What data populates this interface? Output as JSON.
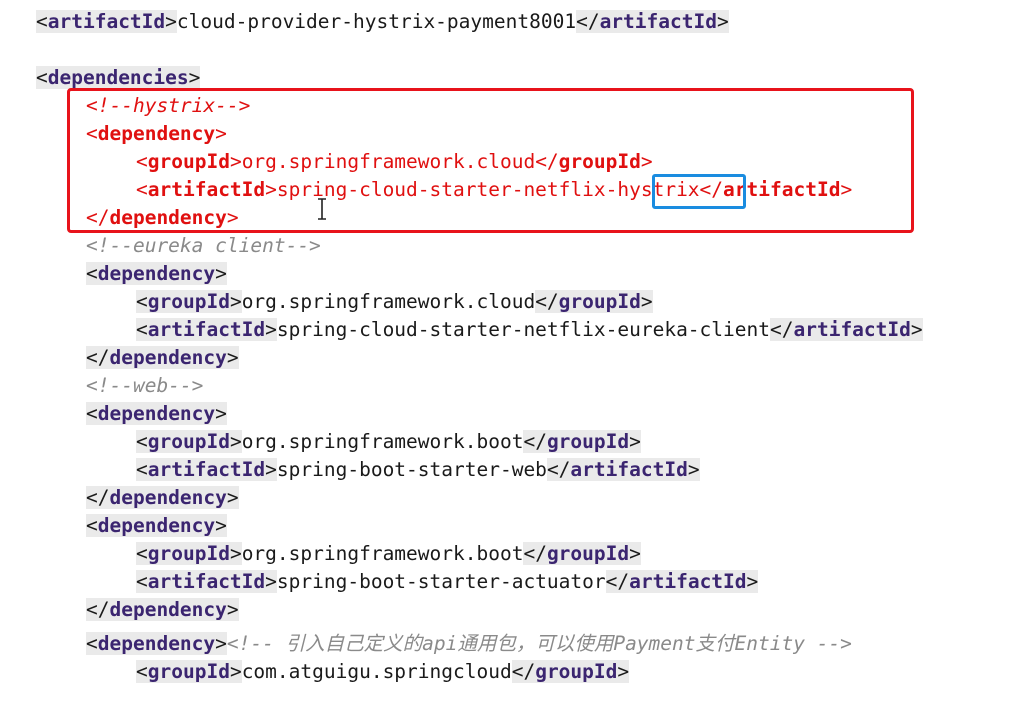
{
  "editor": {
    "lines": [
      {
        "tokens": [
          {
            "k": "br",
            "t": "<"
          },
          {
            "k": "tag",
            "t": "artifactId"
          },
          {
            "k": "br",
            "t": ">"
          },
          {
            "k": "text",
            "t": "cloud-provider-hystrix-payment8001"
          },
          {
            "k": "br",
            "t": "</"
          },
          {
            "k": "tag",
            "t": "artifactId"
          },
          {
            "k": "br",
            "t": ">"
          }
        ]
      },
      {
        "tokens": []
      },
      {
        "tokens": [
          {
            "k": "br",
            "t": "<"
          },
          {
            "k": "tag",
            "t": "dependencies"
          },
          {
            "k": "br",
            "t": ">"
          }
        ]
      },
      {
        "hl": true,
        "tokens": [
          {
            "k": "comment",
            "t": "<!--hystrix-->"
          }
        ]
      },
      {
        "hl": true,
        "tokens": [
          {
            "k": "br",
            "t": "<"
          },
          {
            "k": "tag",
            "t": "dependency"
          },
          {
            "k": "br",
            "t": ">"
          }
        ]
      },
      {
        "hl": true,
        "tokens": [
          {
            "k": "br",
            "t": "<"
          },
          {
            "k": "tag",
            "t": "groupId"
          },
          {
            "k": "br",
            "t": ">"
          },
          {
            "k": "text",
            "t": "org.springframework.cloud"
          },
          {
            "k": "br",
            "t": "</"
          },
          {
            "k": "tag",
            "t": "groupId"
          },
          {
            "k": "br",
            "t": ">"
          }
        ]
      },
      {
        "hl": true,
        "tokens": [
          {
            "k": "br",
            "t": "<"
          },
          {
            "k": "tag",
            "t": "artifactId"
          },
          {
            "k": "br",
            "t": ">"
          },
          {
            "k": "text",
            "t": "spring-cloud-starter-netflix-hystrix"
          },
          {
            "k": "br",
            "t": "</"
          },
          {
            "k": "tag",
            "t": "artifactId"
          },
          {
            "k": "br",
            "t": ">"
          }
        ]
      },
      {
        "hl": true,
        "tokens": [
          {
            "k": "br",
            "t": "</"
          },
          {
            "k": "tag",
            "t": "dependency"
          },
          {
            "k": "br",
            "t": ">"
          }
        ]
      },
      {
        "tokens": [
          {
            "k": "comment",
            "t": "<!--eureka client-->"
          }
        ]
      },
      {
        "tokens": [
          {
            "k": "br",
            "t": "<"
          },
          {
            "k": "tag",
            "t": "dependency"
          },
          {
            "k": "br",
            "t": ">"
          }
        ]
      },
      {
        "tokens": [
          {
            "k": "br",
            "t": "<"
          },
          {
            "k": "tag",
            "t": "groupId"
          },
          {
            "k": "br",
            "t": ">"
          },
          {
            "k": "text",
            "t": "org.springframework.cloud"
          },
          {
            "k": "br",
            "t": "</"
          },
          {
            "k": "tag",
            "t": "groupId"
          },
          {
            "k": "br",
            "t": ">"
          }
        ]
      },
      {
        "tokens": [
          {
            "k": "br",
            "t": "<"
          },
          {
            "k": "tag",
            "t": "artifactId"
          },
          {
            "k": "br",
            "t": ">"
          },
          {
            "k": "text",
            "t": "spring-cloud-starter-netflix-eureka-client"
          },
          {
            "k": "br",
            "t": "</"
          },
          {
            "k": "tag",
            "t": "artifactId"
          },
          {
            "k": "br",
            "t": ">"
          }
        ]
      },
      {
        "tokens": [
          {
            "k": "br",
            "t": "</"
          },
          {
            "k": "tag",
            "t": "dependency"
          },
          {
            "k": "br",
            "t": ">"
          }
        ]
      },
      {
        "tokens": [
          {
            "k": "comment",
            "t": "<!--web-->"
          }
        ]
      },
      {
        "tokens": [
          {
            "k": "br",
            "t": "<"
          },
          {
            "k": "tag",
            "t": "dependency"
          },
          {
            "k": "br",
            "t": ">"
          }
        ]
      },
      {
        "tokens": [
          {
            "k": "br",
            "t": "<"
          },
          {
            "k": "tag",
            "t": "groupId"
          },
          {
            "k": "br",
            "t": ">"
          },
          {
            "k": "text",
            "t": "org.springframework.boot"
          },
          {
            "k": "br",
            "t": "</"
          },
          {
            "k": "tag",
            "t": "groupId"
          },
          {
            "k": "br",
            "t": ">"
          }
        ]
      },
      {
        "tokens": [
          {
            "k": "br",
            "t": "<"
          },
          {
            "k": "tag",
            "t": "artifactId"
          },
          {
            "k": "br",
            "t": ">"
          },
          {
            "k": "text",
            "t": "spring-boot-starter-web"
          },
          {
            "k": "br",
            "t": "</"
          },
          {
            "k": "tag",
            "t": "artifactId"
          },
          {
            "k": "br",
            "t": ">"
          }
        ]
      },
      {
        "tokens": [
          {
            "k": "br",
            "t": "</"
          },
          {
            "k": "tag",
            "t": "dependency"
          },
          {
            "k": "br",
            "t": ">"
          }
        ]
      },
      {
        "tokens": [
          {
            "k": "br",
            "t": "<"
          },
          {
            "k": "tag",
            "t": "dependency"
          },
          {
            "k": "br",
            "t": ">"
          }
        ]
      },
      {
        "tokens": [
          {
            "k": "br",
            "t": "<"
          },
          {
            "k": "tag",
            "t": "groupId"
          },
          {
            "k": "br",
            "t": ">"
          },
          {
            "k": "text",
            "t": "org.springframework.boot"
          },
          {
            "k": "br",
            "t": "</"
          },
          {
            "k": "tag",
            "t": "groupId"
          },
          {
            "k": "br",
            "t": ">"
          }
        ]
      },
      {
        "tokens": [
          {
            "k": "br",
            "t": "<"
          },
          {
            "k": "tag",
            "t": "artifactId"
          },
          {
            "k": "br",
            "t": ">"
          },
          {
            "k": "text",
            "t": "spring-boot-starter-actuator"
          },
          {
            "k": "br",
            "t": "</"
          },
          {
            "k": "tag",
            "t": "artifactId"
          },
          {
            "k": "br",
            "t": ">"
          }
        ]
      },
      {
        "tokens": [
          {
            "k": "br",
            "t": "</"
          },
          {
            "k": "tag",
            "t": "dependency"
          },
          {
            "k": "br",
            "t": ">"
          }
        ]
      },
      {
        "tokens": [
          {
            "k": "br",
            "t": "<"
          },
          {
            "k": "tag",
            "t": "dependency"
          },
          {
            "k": "br",
            "t": ">"
          },
          {
            "k": "comment",
            "t": "<!-- 引入自己定义的api通用包，可以使用Payment支付Entity -->"
          }
        ]
      },
      {
        "tokens": [
          {
            "k": "br",
            "t": "<"
          },
          {
            "k": "tag",
            "t": "groupId"
          },
          {
            "k": "br",
            "t": ">"
          },
          {
            "k": "text",
            "t": "com.atguigu.springcloud"
          },
          {
            "k": "br",
            "t": "</"
          },
          {
            "k": "tag",
            "t": "groupId"
          },
          {
            "k": "br",
            "t": ">"
          }
        ]
      }
    ]
  },
  "annotations": {
    "red_box_color": "#e8131b",
    "blue_box_color": "#1a8ce0",
    "cursor_icon": "text-cursor-icon"
  },
  "colors": {
    "tag": "#3b2570",
    "text": "#1a1a1a",
    "comment": "#8a8a8a",
    "highlight": "#e01010",
    "tag_background": "#eaeaea"
  }
}
